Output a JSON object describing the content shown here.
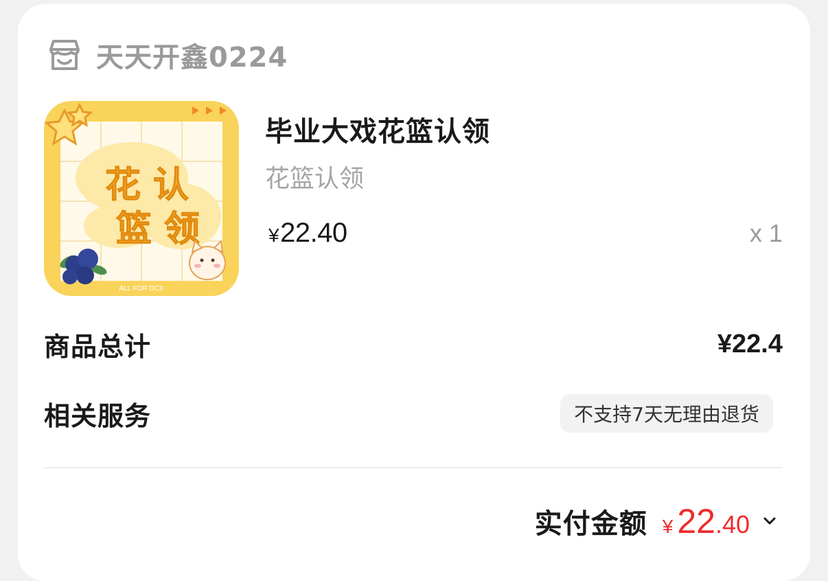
{
  "shop": {
    "icon": "store-icon",
    "name": "天天开鑫0224"
  },
  "product": {
    "image_text_top": "花 认",
    "image_text_bottom": "篮 领",
    "image_caption": "ALL FOR DCX",
    "title": "毕业大戏花篮认领",
    "spec": "花篮认领",
    "price_symbol": "¥",
    "price": "22.40",
    "quantity": "x 1"
  },
  "summary": {
    "goods_total_label": "商品总计",
    "goods_total_value": "¥22.4",
    "services_label": "相关服务",
    "services_badge": "不支持7天无理由退货"
  },
  "payment": {
    "label": "实付金额",
    "symbol": "¥",
    "amount_int": "22",
    "amount_dec": ".40",
    "expand_icon": "chevron-down-icon"
  },
  "colors": {
    "accent_red": "#ef2b2b",
    "thumb_yellow": "#f9d35a",
    "thumb_text_orange": "#f5a623"
  }
}
